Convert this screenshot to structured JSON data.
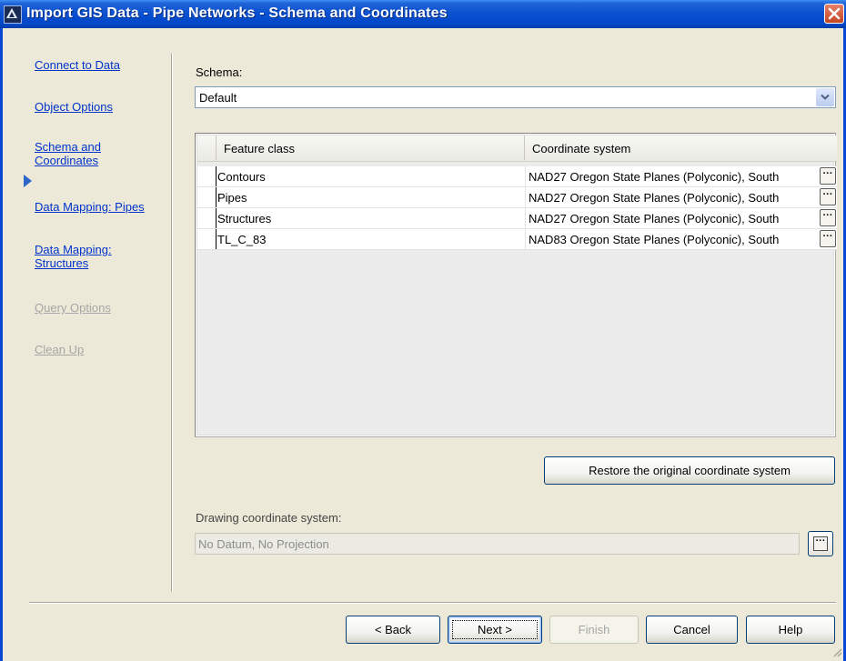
{
  "window": {
    "title": "Import GIS Data - Pipe Networks - Schema and Coordinates"
  },
  "nav": {
    "items": [
      {
        "label": "Connect to Data",
        "state": "enabled"
      },
      {
        "label": "Object Options",
        "state": "enabled"
      },
      {
        "label": "Schema and\nCoordinates",
        "state": "current"
      },
      {
        "label": "Data Mapping: Pipes",
        "state": "enabled"
      },
      {
        "label": "Data Mapping:\nStructures",
        "state": "enabled"
      },
      {
        "label": "Query Options",
        "state": "disabled"
      },
      {
        "label": "Clean Up",
        "state": "disabled"
      }
    ]
  },
  "schema": {
    "label": "Schema:",
    "value": "Default"
  },
  "grid": {
    "columns": [
      "Feature class",
      "Coordinate system"
    ],
    "rows": [
      {
        "feature_class": "Contours",
        "coordinate_system": "NAD27 Oregon State Planes (Polyconic), South"
      },
      {
        "feature_class": "Pipes",
        "coordinate_system": "NAD27 Oregon State Planes (Polyconic), South"
      },
      {
        "feature_class": "Structures",
        "coordinate_system": "NAD27 Oregon State Planes (Polyconic), South"
      },
      {
        "feature_class": "TL_C_83",
        "coordinate_system": "NAD83 Oregon State Planes (Polyconic), South"
      }
    ],
    "ellipsis": "···"
  },
  "restore_button": {
    "label": "Restore the original coordinate system"
  },
  "drawing_cs": {
    "label": "Drawing coordinate system:",
    "value": "No Datum, No Projection",
    "ellipsis": "···"
  },
  "footer": {
    "back": "< Back",
    "next": "Next >",
    "finish": "Finish",
    "cancel": "Cancel",
    "help": "Help"
  },
  "colors": {
    "titlebar": "#0a4fcf",
    "link": "#0033cc",
    "disabled_text": "#a6a6a6",
    "dialog_bg": "#ece9d8"
  }
}
